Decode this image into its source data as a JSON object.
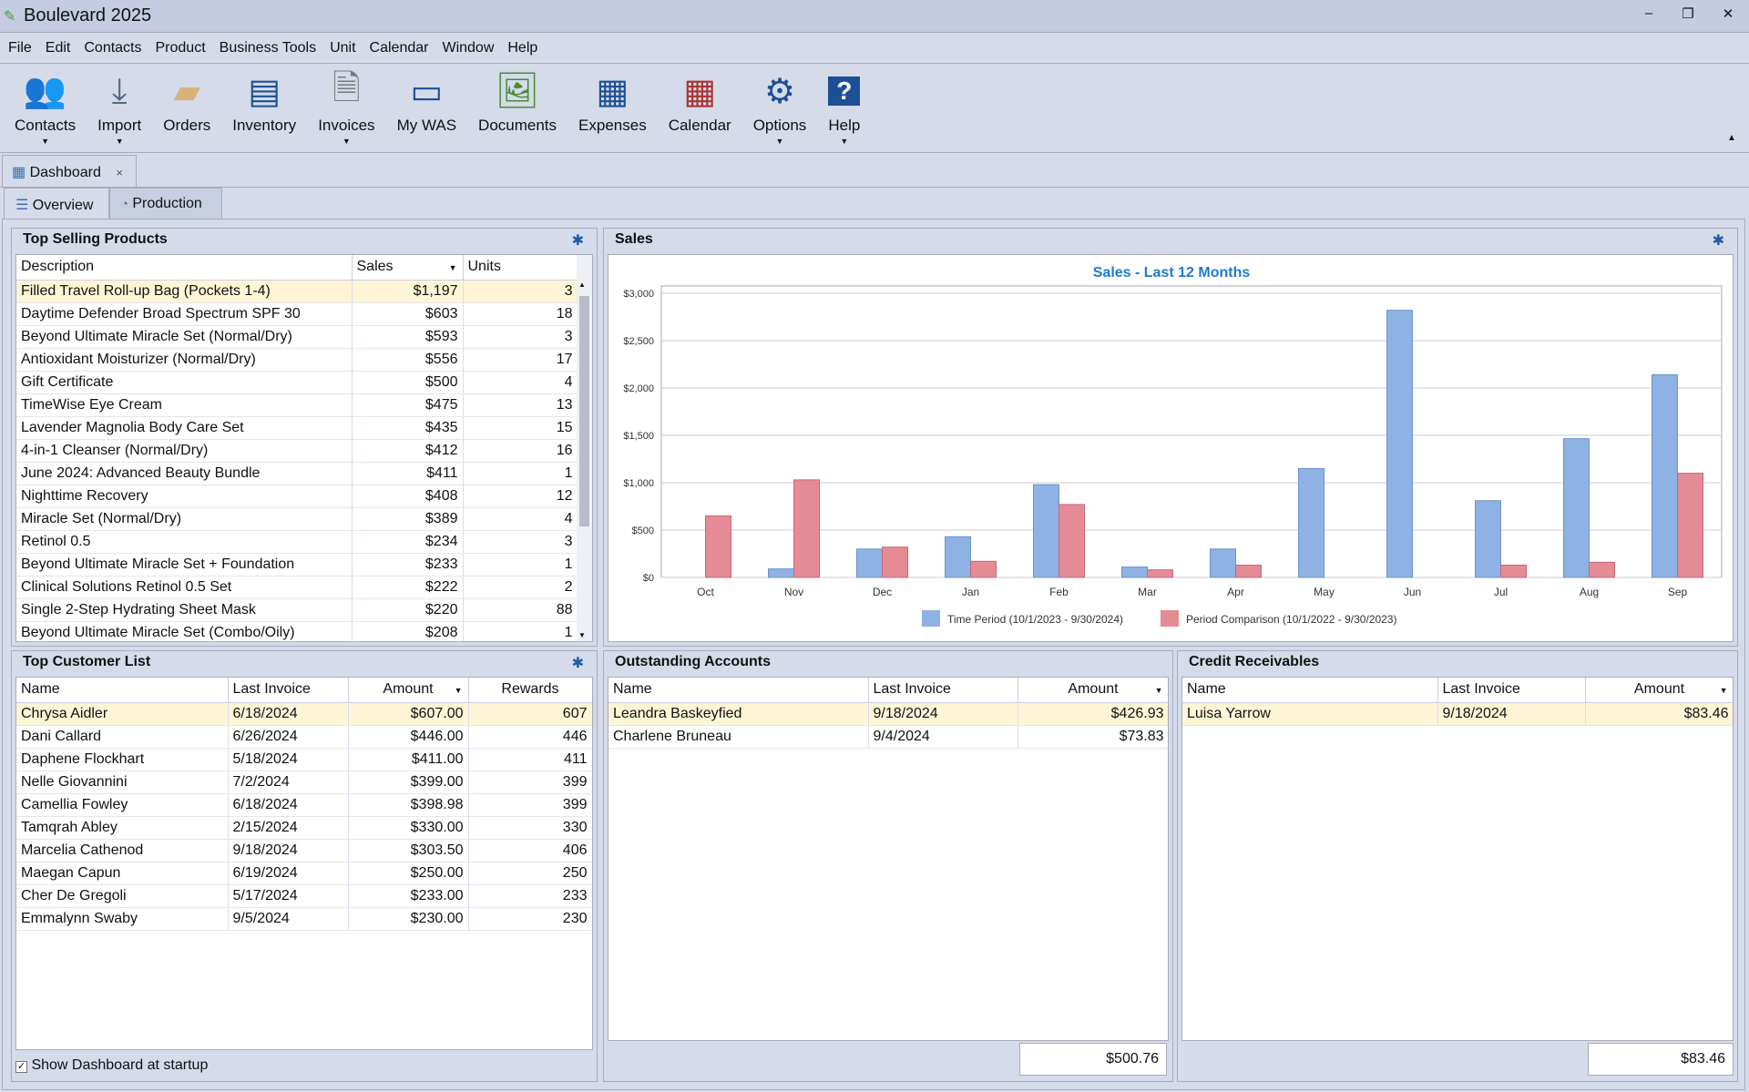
{
  "app": {
    "title": "Boulevard 2025"
  },
  "menu": [
    "File",
    "Edit",
    "Contacts",
    "Product",
    "Business Tools",
    "Unit",
    "Calendar",
    "Window",
    "Help"
  ],
  "toolbar": [
    {
      "label": "Contacts",
      "icon": "contacts-icon",
      "dropdown": true
    },
    {
      "label": "Import",
      "icon": "import-icon",
      "dropdown": true
    },
    {
      "label": "Orders",
      "icon": "orders-box-icon",
      "dropdown": false
    },
    {
      "label": "Inventory",
      "icon": "inventory-shelf-icon",
      "dropdown": false
    },
    {
      "label": "Invoices",
      "icon": "invoice-document-icon",
      "dropdown": true
    },
    {
      "label": "My WAS",
      "icon": "tablet-icon",
      "dropdown": false
    },
    {
      "label": "Documents",
      "icon": "image-document-icon",
      "dropdown": false
    },
    {
      "label": "Expenses",
      "icon": "calculator-icon",
      "dropdown": false
    },
    {
      "label": "Calendar",
      "icon": "calendar-icon",
      "dropdown": false
    },
    {
      "label": "Options",
      "icon": "gear-icon",
      "dropdown": true
    },
    {
      "label": "Help",
      "icon": "help-icon",
      "dropdown": true
    }
  ],
  "doc_tab": {
    "label": "Dashboard",
    "close": "×"
  },
  "sub_tabs": [
    {
      "label": "Overview",
      "active": true
    },
    {
      "label": "Production",
      "active": false
    }
  ],
  "top_products": {
    "title": "Top Selling Products",
    "columns": [
      "Description",
      "Sales",
      "Units"
    ],
    "rows": [
      [
        "Filled Travel Roll-up Bag (Pockets 1-4)",
        "$1,197",
        "3"
      ],
      [
        "Daytime Defender Broad Spectrum SPF 30",
        "$603",
        "18"
      ],
      [
        "Beyond Ultimate Miracle Set (Normal/Dry)",
        "$593",
        "3"
      ],
      [
        "Antioxidant Moisturizer (Normal/Dry)",
        "$556",
        "17"
      ],
      [
        "Gift Certificate",
        "$500",
        "4"
      ],
      [
        "TimeWise Eye Cream",
        "$475",
        "13"
      ],
      [
        "Lavender Magnolia Body Care Set",
        "$435",
        "15"
      ],
      [
        "4-in-1 Cleanser (Normal/Dry)",
        "$412",
        "16"
      ],
      [
        "June 2024: Advanced Beauty Bundle",
        "$411",
        "1"
      ],
      [
        "Nighttime Recovery",
        "$408",
        "12"
      ],
      [
        "Miracle Set (Normal/Dry)",
        "$389",
        "4"
      ],
      [
        "Retinol 0.5",
        "$234",
        "3"
      ],
      [
        "Beyond Ultimate Miracle Set + Foundation",
        "$233",
        "1"
      ],
      [
        "Clinical Solutions Retinol 0.5 Set",
        "$222",
        "2"
      ],
      [
        "Single 2-Step Hydrating Sheet Mask",
        "$220",
        "88"
      ],
      [
        "Beyond Ultimate Miracle Set (Combo/Oily)",
        "$208",
        "1"
      ]
    ]
  },
  "sales": {
    "title": "Sales"
  },
  "chart_data": {
    "type": "bar",
    "title": "Sales - Last 12 Months",
    "xlabel": "",
    "ylabel": "",
    "categories": [
      "Oct",
      "Nov",
      "Dec",
      "Jan",
      "Feb",
      "Mar",
      "Apr",
      "May",
      "Jun",
      "Jul",
      "Aug",
      "Sep"
    ],
    "ylim": [
      0,
      3000
    ],
    "yticks": [
      "$0",
      "$500",
      "$1,000",
      "$1,500",
      "$2,000",
      "$2,500",
      "$3,000"
    ],
    "grid": true,
    "legend": "bottom",
    "series": [
      {
        "name": "Time Period (10/1/2023 - 9/30/2024)",
        "color": "#8eb2e3",
        "values": [
          0,
          90,
          300,
          430,
          980,
          110,
          300,
          1150,
          2820,
          810,
          1465,
          2140
        ]
      },
      {
        "name": "Period Comparison (10/1/2022 - 9/30/2023)",
        "color": "#e48b95",
        "values": [
          650,
          1030,
          320,
          170,
          770,
          80,
          130,
          0,
          0,
          130,
          160,
          1100
        ]
      }
    ]
  },
  "customers": {
    "title": "Top Customer List",
    "columns": [
      "Name",
      "Last Invoice",
      "Amount",
      "Rewards"
    ],
    "rows": [
      [
        "Chrysa Aidler",
        "6/18/2024",
        "$607.00",
        "607"
      ],
      [
        "Dani Callard",
        "6/26/2024",
        "$446.00",
        "446"
      ],
      [
        "Daphene Flockhart",
        "5/18/2024",
        "$411.00",
        "411"
      ],
      [
        "Nelle Giovannini",
        "7/2/2024",
        "$399.00",
        "399"
      ],
      [
        "Camellia Fowley",
        "6/18/2024",
        "$398.98",
        "399"
      ],
      [
        "Tamqrah Abley",
        "2/15/2024",
        "$330.00",
        "330"
      ],
      [
        "Marcelia Cathenod",
        "9/18/2024",
        "$303.50",
        "406"
      ],
      [
        "Maegan Capun",
        "6/19/2024",
        "$250.00",
        "250"
      ],
      [
        "Cher De Gregoli",
        "5/17/2024",
        "$233.00",
        "233"
      ],
      [
        "Emmalynn Swaby",
        "9/5/2024",
        "$230.00",
        "230"
      ]
    ],
    "show_startup": "Show Dashboard at startup",
    "show_startup_checked": true
  },
  "outstanding": {
    "title": "Outstanding Accounts",
    "columns": [
      "Name",
      "Last Invoice",
      "Amount"
    ],
    "rows": [
      [
        "Leandra Baskeyfied",
        "9/18/2024",
        "$426.93"
      ],
      [
        "Charlene Bruneau",
        "9/4/2024",
        "$73.83"
      ]
    ],
    "total": "$500.76"
  },
  "credit": {
    "title": "Credit Receivables",
    "columns": [
      "Name",
      "Last Invoice",
      "Amount"
    ],
    "rows": [
      [
        "Luisa Yarrow",
        "9/18/2024",
        "$83.46"
      ]
    ],
    "total": "$83.46"
  }
}
